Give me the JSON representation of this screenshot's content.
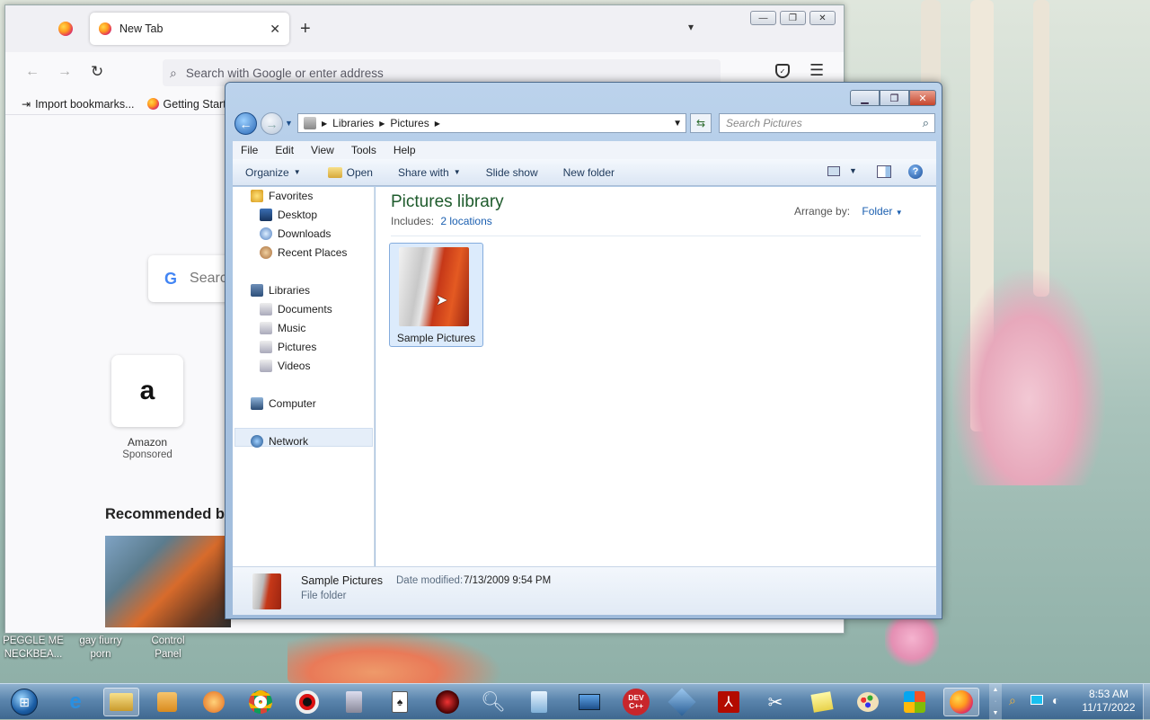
{
  "firefox": {
    "tab_title": "New Tab",
    "url_placeholder": "Search with Google or enter address",
    "bookmarks": [
      "Import bookmarks...",
      "Getting Start"
    ],
    "search_partial": "Searc",
    "shortcut_name": "Amazon",
    "shortcut_sub": "Sponsored",
    "recommended": "Recommended by"
  },
  "explorer": {
    "breadcrumb": [
      "Libraries",
      "Pictures"
    ],
    "search_placeholder": "Search Pictures",
    "menu": [
      "File",
      "Edit",
      "View",
      "Tools",
      "Help"
    ],
    "commands": [
      "Organize",
      "Open",
      "Share with",
      "Slide show",
      "New folder"
    ],
    "nav": {
      "favorites": "Favorites",
      "favorites_items": [
        "Desktop",
        "Downloads",
        "Recent Places"
      ],
      "libraries": "Libraries",
      "libraries_items": [
        "Documents",
        "Music",
        "Pictures",
        "Videos"
      ],
      "computer": "Computer",
      "network": "Network"
    },
    "library_title": "Pictures library",
    "includes_label": "Includes:",
    "includes_link": "2 locations",
    "arrange_label": "Arrange by:",
    "arrange_value": "Folder",
    "item_name": "Sample Pictures",
    "details": {
      "name": "Sample Pictures",
      "date_label": "Date modified:",
      "date_value": "7/13/2009 9:54 PM",
      "type": "File folder"
    }
  },
  "desktop_icons": [
    {
      "line1": "PEGGLE ME",
      "line2": "NECKBEA..."
    },
    {
      "line1": "gay fiurry",
      "line2": "porn"
    },
    {
      "line1": "Control",
      "line2": "Panel"
    }
  ],
  "taskbar": {
    "devcpp_label": "DEV C++",
    "time": "8:53 AM",
    "date": "11/17/2022"
  }
}
